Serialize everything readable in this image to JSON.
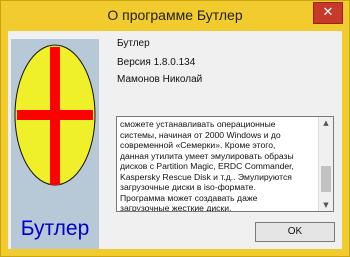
{
  "window": {
    "title": "О программе Бутлер",
    "close_glyph": "✕"
  },
  "logo": {
    "text": "Бутлер",
    "colors": {
      "background": "#b7c8d6",
      "ellipse": "#f0f02a",
      "cross": "#ff0000",
      "text": "#0000cc"
    }
  },
  "info": {
    "product": "Бутлер",
    "version": "Версия 1.8.0.134",
    "author": "Мамонов Николай"
  },
  "memo": {
    "lines": [
      "сможете устанавливать операционные",
      "системы, начиная от 2000 Windows и до",
      "современной «Семерки». Кроме этого,",
      "данная утилита умеет эмулировать образы",
      "дисков с Partition Magic, ERDC Commander,",
      "Kaspersky Rescue Disk и т.д.. Эмулируются",
      "загрузочные диски в iso-формате.",
      "Программа может создавать даже",
      "загрузочные жесткие диски."
    ],
    "scroll_up": "▲",
    "scroll_down": "▼",
    "scroll_position": 0.85
  },
  "buttons": {
    "ok": "OK"
  },
  "colors": {
    "title_bar": "#f2cb2e",
    "close_button": "#c7392a"
  }
}
